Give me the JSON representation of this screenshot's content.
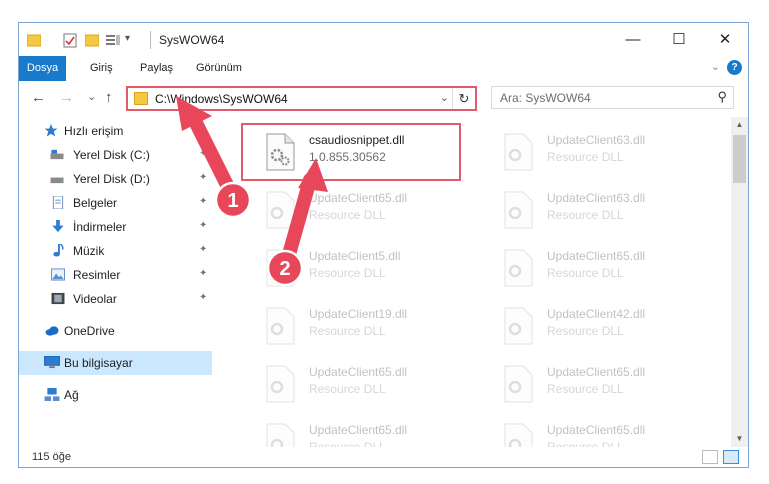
{
  "window": {
    "title": "SysWOW64",
    "minimize_glyph": "—",
    "maximize_glyph": "☐",
    "close_glyph": "✕"
  },
  "ribbon": {
    "tabs": [
      "Dosya",
      "Giriş",
      "Paylaş",
      "Görünüm"
    ],
    "help_glyph": "?",
    "collapse_glyph": "⌄"
  },
  "navigation": {
    "back_glyph": "←",
    "forward_glyph": "→",
    "recent_glyph": "⌄",
    "up_glyph": "↑",
    "address_path": "C:\\Windows\\SysWOW64",
    "address_dropdown_glyph": "⌄",
    "refresh_glyph": "↻",
    "search_placeholder": "Ara: SysWOW64",
    "search_glyph": "⚲"
  },
  "sidebar": {
    "items": [
      {
        "label": "Hızlı erişim",
        "icon": "star-icon",
        "pinned": false
      },
      {
        "label": "Yerel Disk (C:)",
        "icon": "drive-icon",
        "pinned": true
      },
      {
        "label": "Yerel Disk (D:)",
        "icon": "drive-icon",
        "pinned": true
      },
      {
        "label": "Belgeler",
        "icon": "document-icon",
        "pinned": true
      },
      {
        "label": "İndirmeler",
        "icon": "download-icon",
        "pinned": true
      },
      {
        "label": "Müzik",
        "icon": "music-icon",
        "pinned": true
      },
      {
        "label": "Resimler",
        "icon": "pictures-icon",
        "pinned": true
      },
      {
        "label": "Videolar",
        "icon": "video-icon",
        "pinned": true
      },
      {
        "label": "OneDrive",
        "icon": "cloud-icon",
        "pinned": false
      },
      {
        "label": "Bu bilgisayar",
        "icon": "computer-icon",
        "pinned": false,
        "selected": true
      },
      {
        "label": "Ağ",
        "icon": "network-icon",
        "pinned": false
      }
    ],
    "pin_glyph": "📌"
  },
  "files": [
    {
      "name": "csaudiosnippet.dll",
      "desc": "1.0.855.30562",
      "highlighted": true
    },
    {
      "name": "UpdateClient63.dll",
      "desc": "Resource DLL"
    },
    {
      "name": "UpdateClient65.dll",
      "desc": "Resource DLL"
    },
    {
      "name": "UpdateClient63.dll",
      "desc": "Resource DLL"
    },
    {
      "name": "UpdateClient5.dll",
      "desc": "Resource DLL"
    },
    {
      "name": "UpdateClient65.dll",
      "desc": "Resource DLL"
    },
    {
      "name": "UpdateClient19.dll",
      "desc": "Resource DLL"
    },
    {
      "name": "UpdateClient42.dll",
      "desc": "Resource DLL"
    },
    {
      "name": "UpdateClient65.dll",
      "desc": "Resource DLL"
    },
    {
      "name": "UpdateClient65.dll",
      "desc": "Resource DLL"
    },
    {
      "name": "UpdateClient65.dll",
      "desc": "Resource DLL"
    },
    {
      "name": "UpdateClient65.dll",
      "desc": "Resource DLL"
    }
  ],
  "status": {
    "item_count": "115 öğe"
  },
  "annotations": {
    "step1": "1",
    "step2": "2"
  },
  "colors": {
    "accent": "#1979ca",
    "highlight_red": "#e35b6a",
    "selection": "#cce8ff"
  }
}
